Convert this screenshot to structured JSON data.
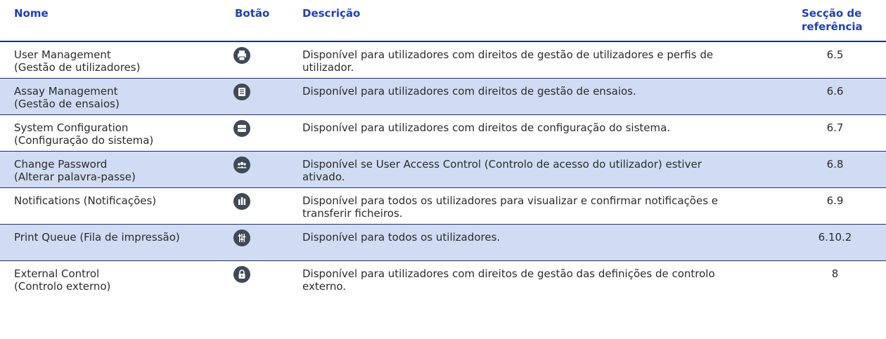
{
  "headers": {
    "name": "Nome",
    "button": "Botão",
    "description": "Descrição",
    "reference_line1": "Secção de",
    "reference_line2": "referência"
  },
  "rows": [
    {
      "name_line1": "User Management",
      "name_line2": "(Gestão de utilizadores)",
      "icon": "printer-icon",
      "description_line1": "Disponível para utilizadores com direitos de gestão de utilizadores e perfis de",
      "description_line2": "utilizador.",
      "reference": "6.5"
    },
    {
      "name_line1": "Assay Management",
      "name_line2": "(Gestão de ensaios)",
      "icon": "list-document-icon",
      "description_line1": "Disponível para utilizadores com direitos de gestão de ensaios.",
      "description_line2": "",
      "reference": "6.6"
    },
    {
      "name_line1": "System Configuration",
      "name_line2": "(Configuração do sistema)",
      "icon": "server-icon",
      "description_line1": "Disponível para utilizadores com direitos de configuração do sistema.",
      "description_line2": "",
      "reference": "6.7"
    },
    {
      "name_line1": "Change Password",
      "name_line2": "(Alterar palavra-passe)",
      "icon": "users-group-icon",
      "description_line1": "Disponível se User Access Control (Controlo de acesso do utilizador) estiver",
      "description_line2": "ativado.",
      "reference": "6.8"
    },
    {
      "name_line1": "Notifications (Notificações)",
      "name_line2": "",
      "icon": "notifications-icon",
      "description_line1": "Disponível para todos os utilizadores para visualizar e confirmar notificações e",
      "description_line2": "transferir ficheiros.",
      "reference": "6.9"
    },
    {
      "name_line1": "Print Queue (Fila de impressão)",
      "name_line2": "",
      "icon": "sliders-icon",
      "description_line1": "Disponível para todos os utilizadores.",
      "description_line2": "",
      "reference": "6.10.2"
    },
    {
      "name_line1": "External Control",
      "name_line2": "(Controlo externo)",
      "icon": "lock-icon",
      "description_line1": "Disponível para utilizadores com direitos de gestão das definições de controlo",
      "description_line2": "externo.",
      "reference": "8"
    }
  ]
}
